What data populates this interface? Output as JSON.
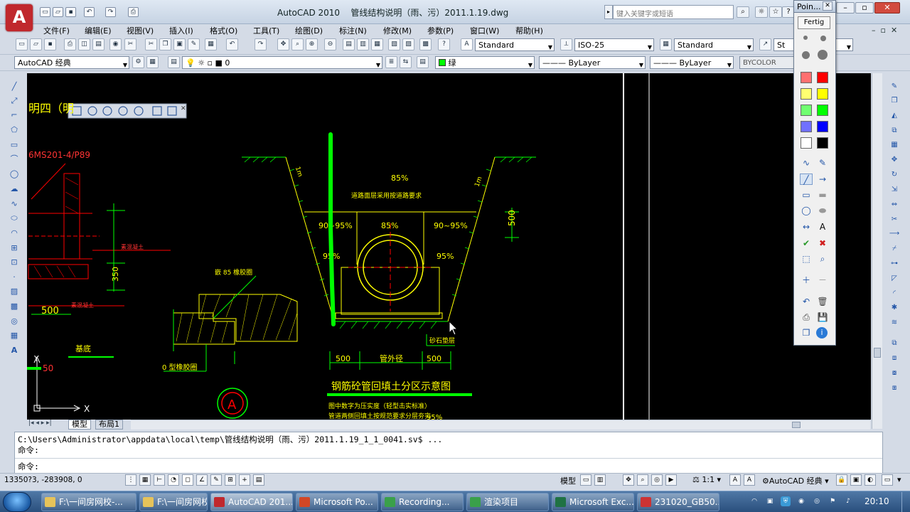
{
  "app": {
    "title": "AutoCAD 2010",
    "document": "管线结构说明（雨、污）2011.1.19.dwg",
    "logo": "A",
    "search_placeholder": "键入关键字或短语"
  },
  "menus": [
    "文件(F)",
    "编辑(E)",
    "视图(V)",
    "插入(I)",
    "格式(O)",
    "工具(T)",
    "绘图(D)",
    "标注(N)",
    "修改(M)",
    "参数(P)",
    "窗口(W)",
    "帮助(H)"
  ],
  "toolbar": {
    "text_style": "Standard",
    "dim_style": "ISO-25",
    "table_style": "Standard",
    "multileader_style": "St"
  },
  "toolbar2": {
    "workspace": "AutoCAD 经典",
    "layer": "0",
    "color": "绿",
    "linetype": "ByLayer",
    "lineweight": "ByLayer",
    "plotstyle": "BYCOLOR"
  },
  "drawing": {
    "title_left": "明四（明",
    "ref_code": "6MS201-4/P89",
    "pct_85_top": "85%",
    "note_top": "道路面层采用按道路要求",
    "pct_90_95_l": "90~95%",
    "pct_85_mid": "85%",
    "pct_90_95_r": "90~95%",
    "pct_95_l": "95%",
    "pct_95_r": "95%",
    "slope_l": "1m",
    "slope_r": "1m",
    "dim_500_v": "500",
    "dim_350": "350",
    "dim_500_l": "500",
    "dim_500_a": "500",
    "dim_pipe": "管外径",
    "dim_500_b": "500",
    "sand_label": "砂石垫层",
    "left_label_1": "素混凝土",
    "left_label_2": "素混凝土",
    "gasket": "嵌 85 橡胶圈",
    "gasket_b": "0 型橡胶圈",
    "bottom_label": "基底",
    "section_title": "钢筋砼管回填土分区示意图",
    "note_1": "图中数字为压实度（轻型击实标准）",
    "note_2": "管道两侧回填土按规范要求分层夯实",
    "pct_bottom": "95%",
    "circle_tag": "A",
    "dim_50": "50",
    "axis_x": "X",
    "axis_y": "Y"
  },
  "tabs": [
    "模型",
    "布局1"
  ],
  "command": {
    "line1": "C:\\Users\\Administrator\\appdata\\local\\temp\\管线结构说明（雨、污）2011.1.19_1_1_0041.sv$ ...",
    "line2": "命令:",
    "line3": "命令:"
  },
  "status": {
    "coords": "13350?3, -283908, 0",
    "model": "模型",
    "scale": "1:1",
    "workspace": "AutoCAD 经典"
  },
  "taskbar": {
    "items": [
      "F:\\一间房网校-...",
      "F:\\一间房网校-...",
      "AutoCAD 201...",
      "Microsoft Po...",
      "Recording...",
      "渲染项目",
      "Microsoft Exc...",
      "231020_GB50..."
    ],
    "clock": "20:10"
  },
  "pointofix": {
    "title": "Poin...",
    "done": "Fertig",
    "colors": [
      "#ff7070",
      "#ff0000",
      "#ffff70",
      "#ffff00",
      "#70ff70",
      "#00ff00",
      "#7070ff",
      "#0000ff",
      "#ffffff",
      "#000000"
    ]
  }
}
